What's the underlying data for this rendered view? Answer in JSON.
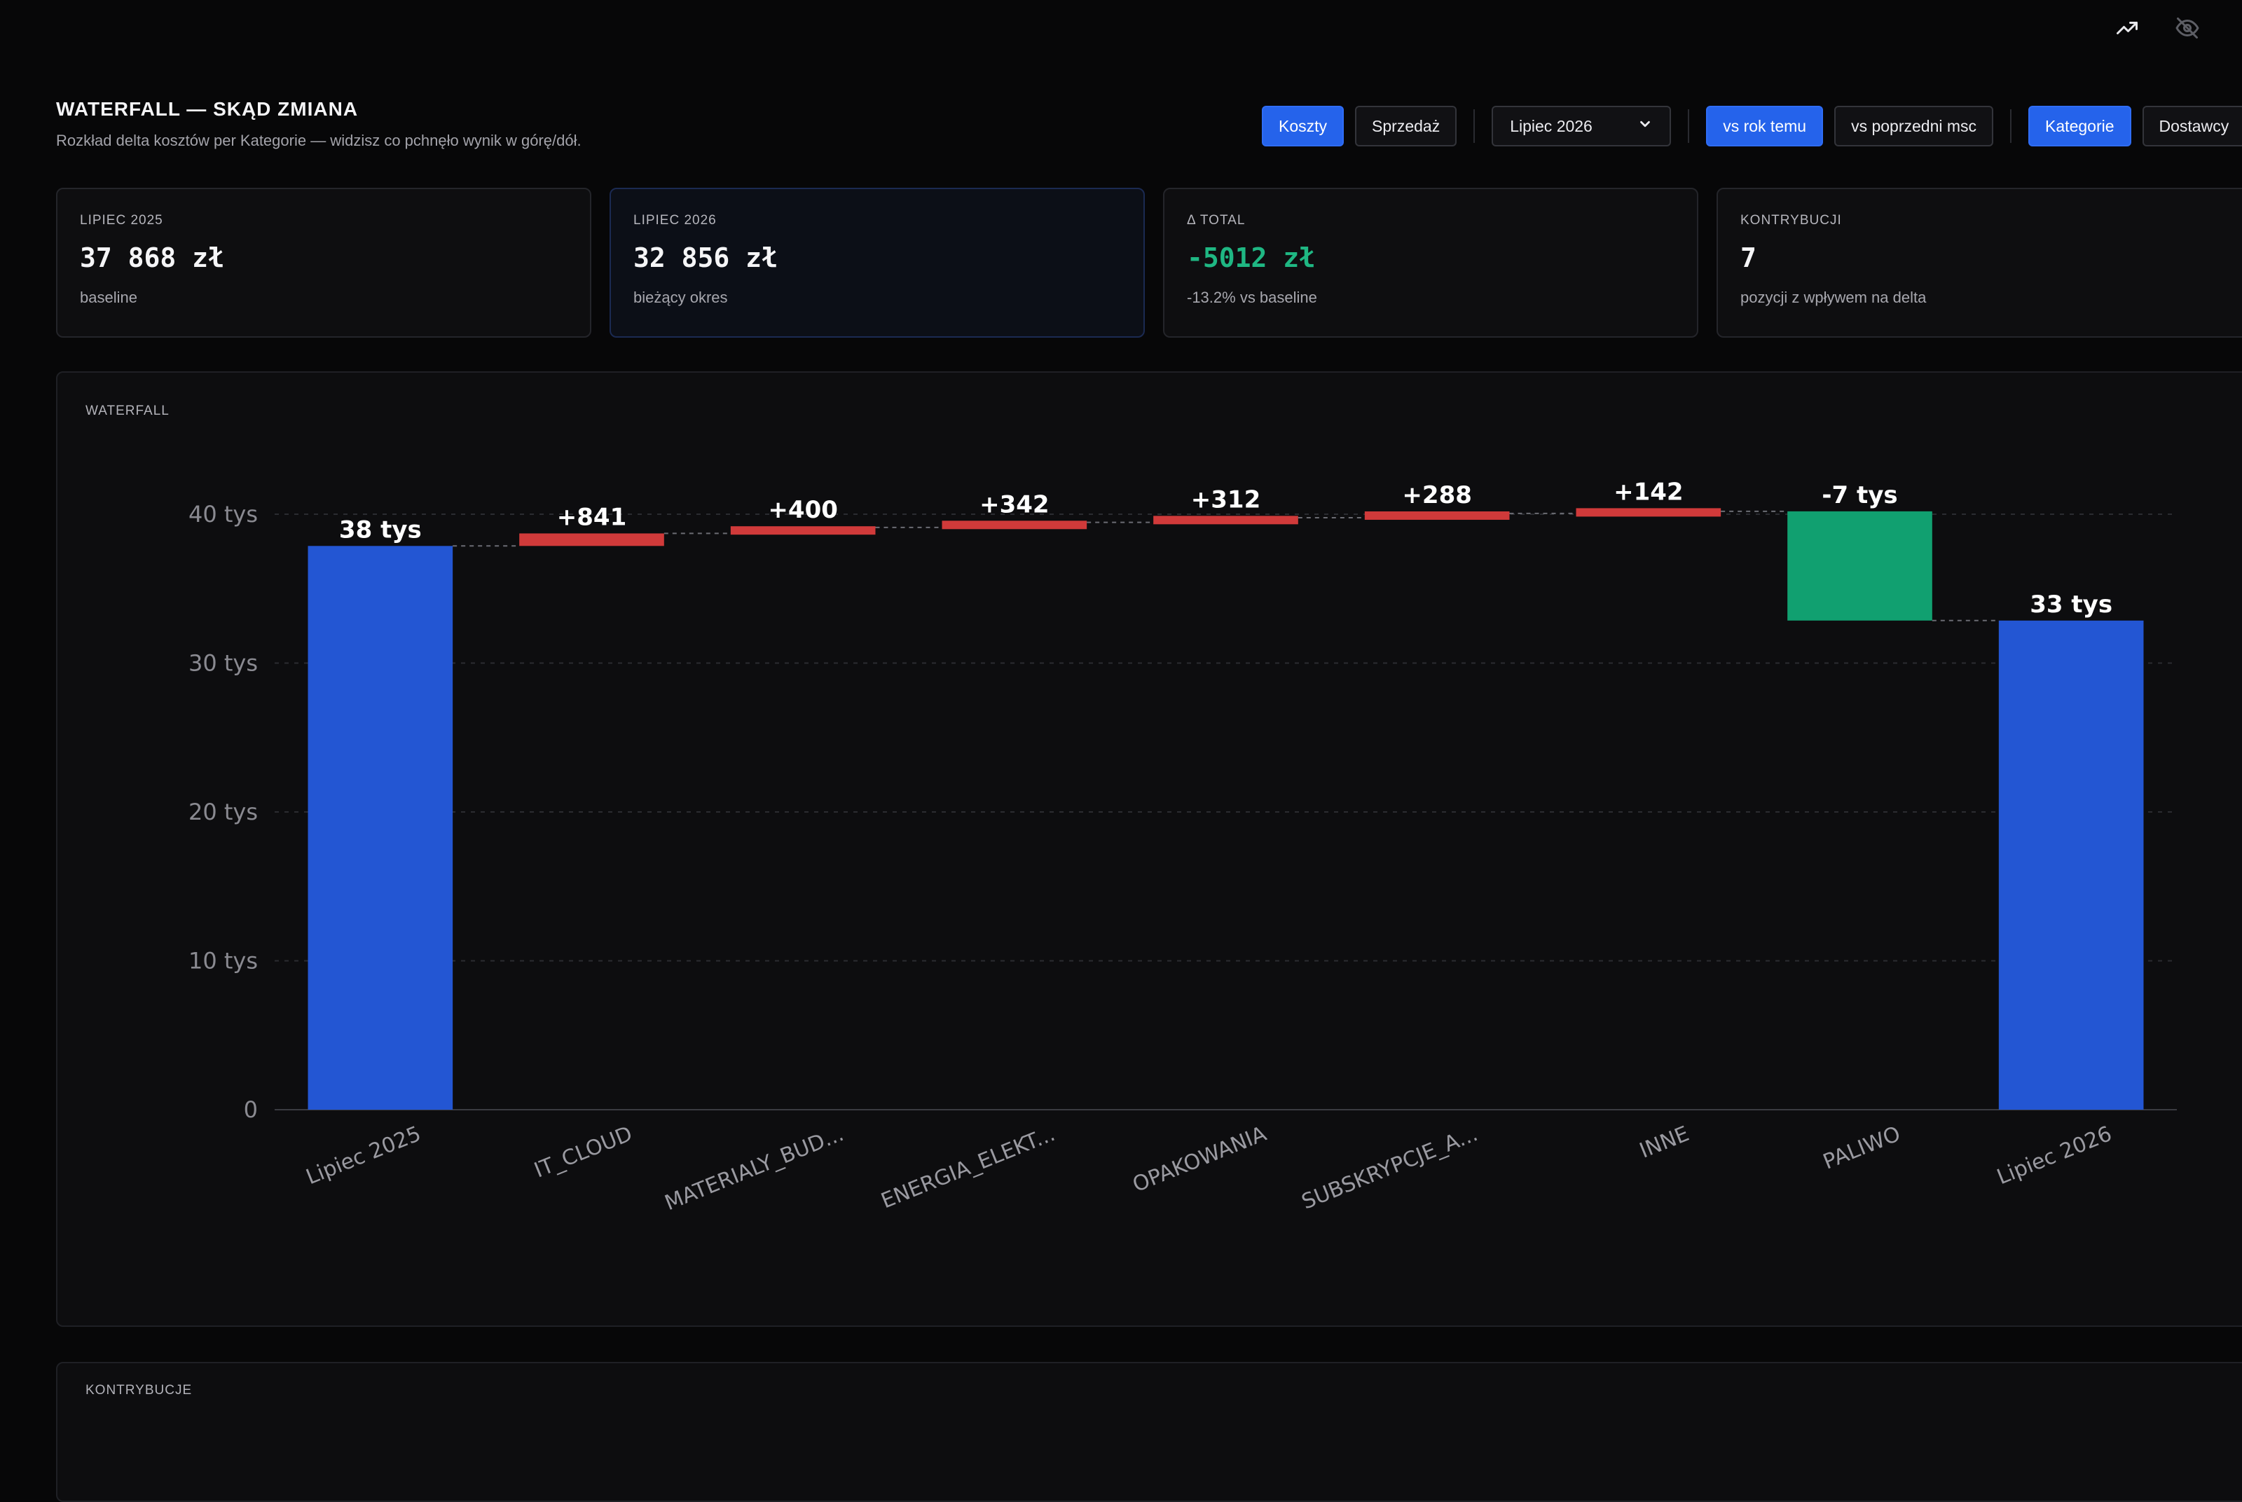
{
  "header": {
    "title": "WATERFALL — SKĄD ZMIANA",
    "subtitle": "Rozkład delta kosztów per Kategorie — widzisz co pchnęło wynik w górę/dół."
  },
  "topbar": {
    "icons": [
      "trend-up-icon",
      "eye-off-icon"
    ]
  },
  "controls": {
    "koszty": "Koszty",
    "sprzedaz": "Sprzedaż",
    "period_select": "Lipiec 2026",
    "vs_year": "vs rok temu",
    "vs_prev": "vs poprzedni msc",
    "kategorie": "Kategorie",
    "dostawcy": "Dostawcy"
  },
  "kpis": [
    {
      "label": "LIPIEC 2025",
      "value": "37 868 zł",
      "sub": "baseline"
    },
    {
      "label": "LIPIEC 2026",
      "value": "32 856 zł",
      "sub": "bieżący okres"
    },
    {
      "label": "Δ TOTAL",
      "value": "-5012 zł",
      "sub": "-13.2% vs baseline"
    },
    {
      "label": "KONTRYBUCJI",
      "value": "7",
      "sub": "pozycji z wpływem na delta"
    }
  ],
  "colors": {
    "accent": "#2563eb",
    "bar_total": "#2356d3",
    "bar_increase": "#d03a3a",
    "bar_decrease": "#11a070",
    "good_text": "#1fb783"
  },
  "chart_panel": {
    "label": "WATERFALL"
  },
  "contrib_panel": {
    "label": "KONTRYBUCJE"
  },
  "chart_data": {
    "type": "bar",
    "subtype": "waterfall",
    "title": "",
    "xlabel": "",
    "ylabel": "",
    "ylim": [
      0,
      40000
    ],
    "yticks": [
      0,
      10000,
      20000,
      30000,
      40000
    ],
    "ytick_labels": [
      "0",
      "10 tys",
      "20 tys",
      "30 tys",
      "40 tys"
    ],
    "grid": true,
    "categories": [
      "Lipiec 2025",
      "IT_CLOUD",
      "MATERIALY_BUD...",
      "ENERGIA_ELEKT...",
      "OPAKOWANIA",
      "SUBSKRYPCJE_A...",
      "INNE",
      "PALIWO",
      "Lipiec 2026"
    ],
    "kinds": [
      "total",
      "delta",
      "delta",
      "delta",
      "delta",
      "delta",
      "delta",
      "delta",
      "total"
    ],
    "values": [
      37868,
      841,
      400,
      342,
      312,
      288,
      142,
      -7337,
      32856
    ],
    "labels": [
      "38 tys",
      "+841",
      "+400",
      "+342",
      "+312",
      "+288",
      "+142",
      "-7 tys",
      "33 tys"
    ]
  }
}
